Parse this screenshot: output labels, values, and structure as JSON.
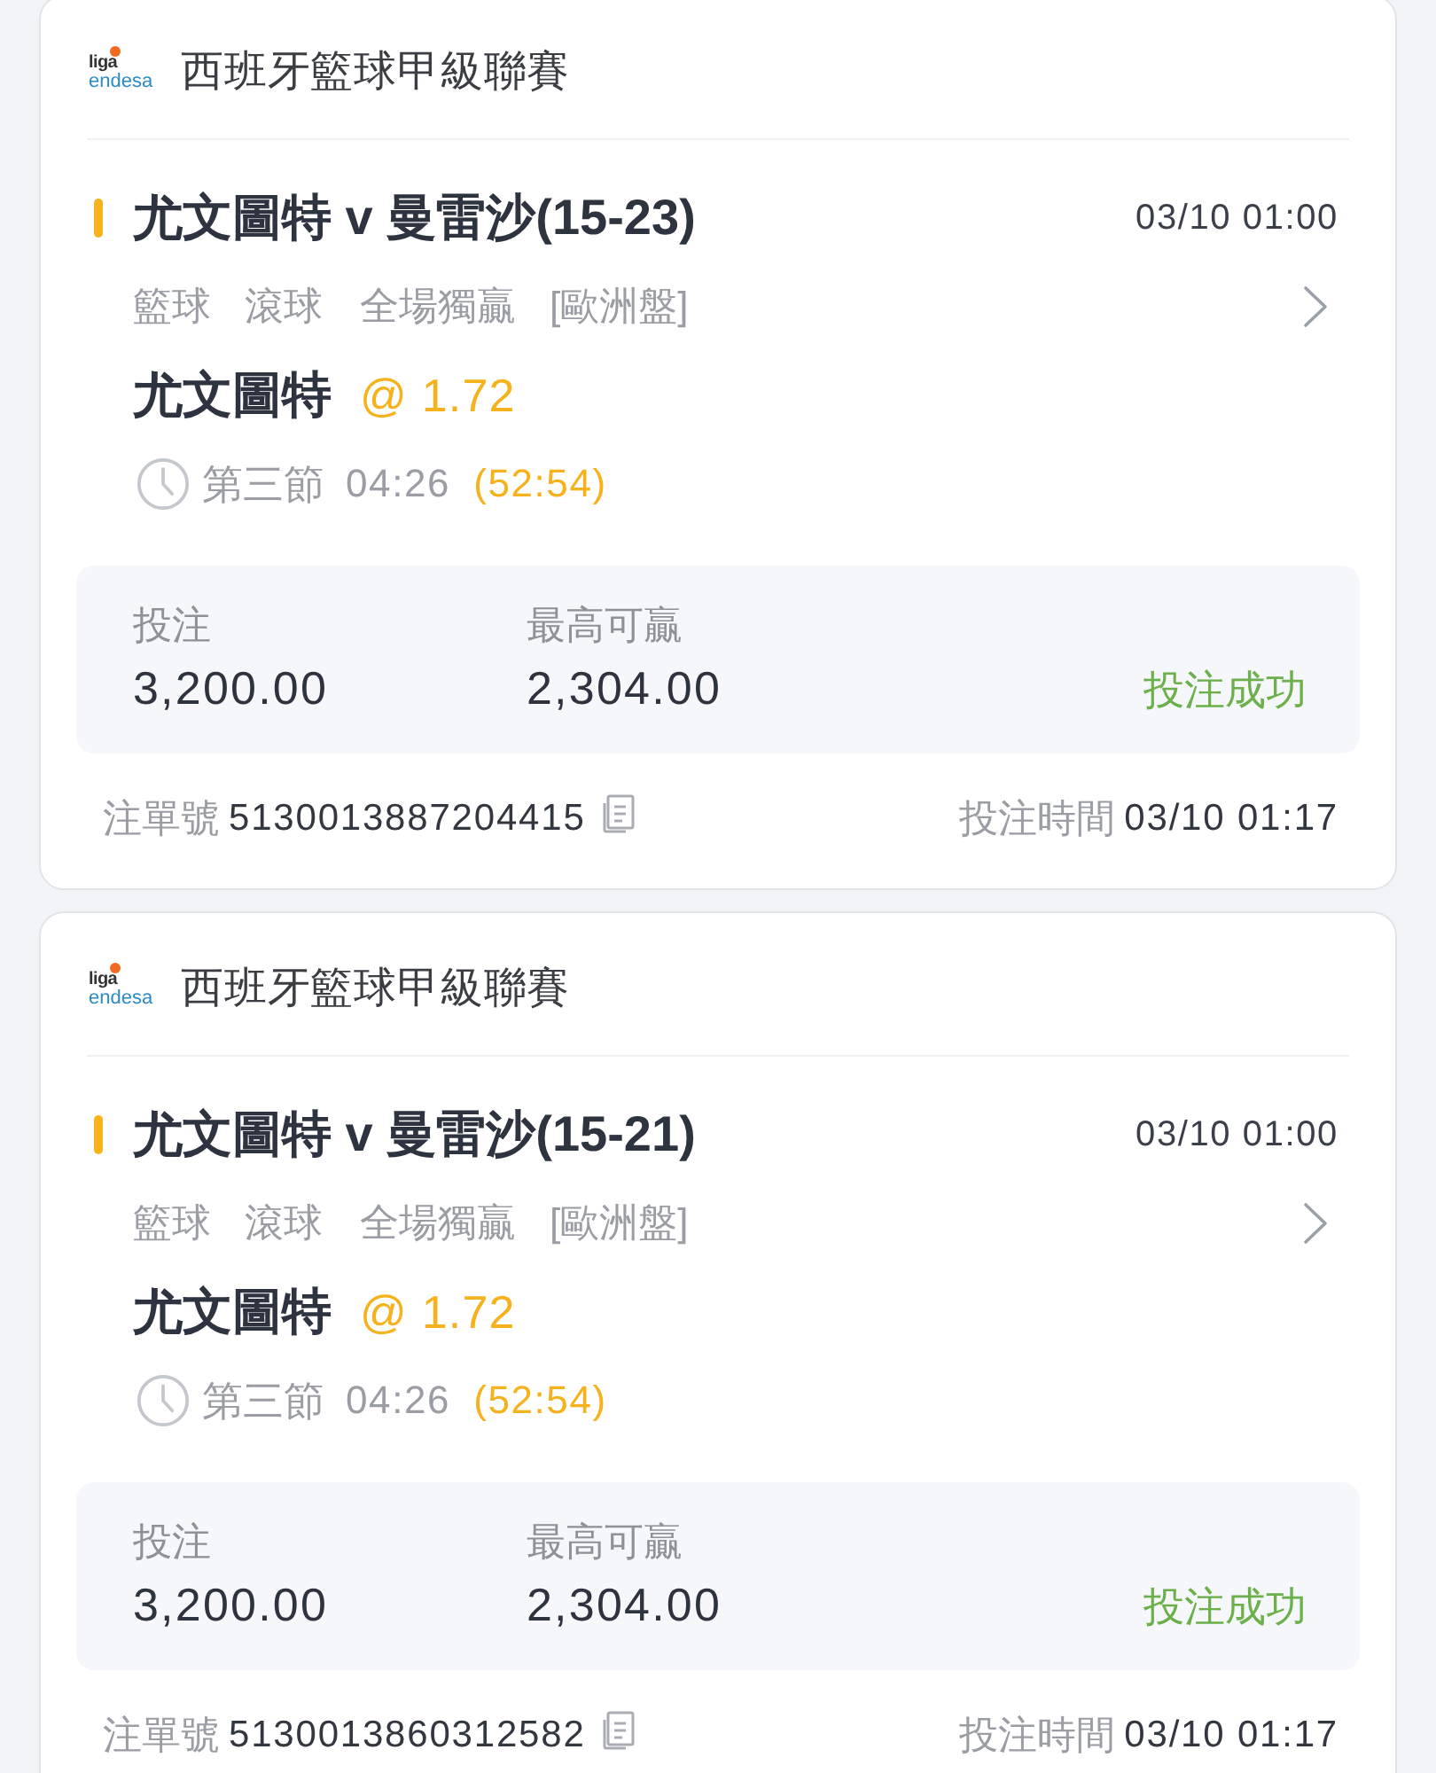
{
  "bets": [
    {
      "league": {
        "logo": [
          "liga",
          "endesa"
        ],
        "name": "西班牙籃球甲級聯賽"
      },
      "match": "尤文圖特 v 曼雷沙(15-23)",
      "start_time": "03/10 01:00",
      "market": [
        "籃球",
        "滾球",
        "全場獨贏",
        "[歐洲盤]"
      ],
      "selection": "尤文圖特",
      "odds": "@ 1.72",
      "period": "第三節",
      "clock": "04:26",
      "elapsed": "(52:54)",
      "stake_label": "投注",
      "stake": "3,200.00",
      "max_win_label": "最高可贏",
      "max_win": "2,304.00",
      "status": "投注成功",
      "ticket_label": "注單號",
      "ticket_no": "5130013887204415",
      "bet_time_label": "投注時間",
      "bet_time": "03/10 01:17"
    },
    {
      "league": {
        "logo": [
          "liga",
          "endesa"
        ],
        "name": "西班牙籃球甲級聯賽"
      },
      "match": "尤文圖特 v 曼雷沙(15-21)",
      "start_time": "03/10 01:00",
      "market": [
        "籃球",
        "滾球",
        "全場獨贏",
        "[歐洲盤]"
      ],
      "selection": "尤文圖特",
      "odds": "@ 1.72",
      "period": "第三節",
      "clock": "04:26",
      "elapsed": "(52:54)",
      "stake_label": "投注",
      "stake": "3,200.00",
      "max_win_label": "最高可贏",
      "max_win": "2,304.00",
      "status": "投注成功",
      "ticket_label": "注單號",
      "ticket_no": "5130013860312582",
      "bet_time_label": "投注時間",
      "bet_time": "03/10 01:17"
    }
  ]
}
